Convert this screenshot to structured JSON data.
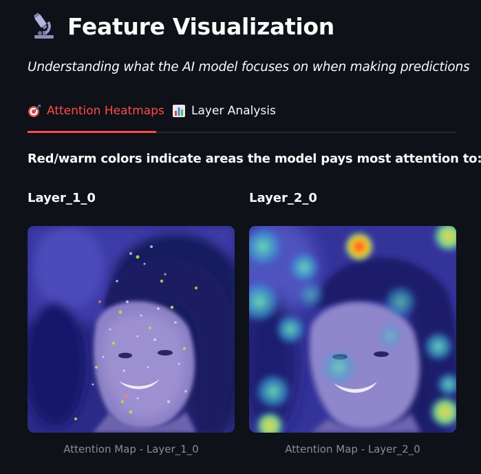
{
  "header": {
    "title": "Feature Visualization",
    "title_icon": "microscope-icon",
    "subtitle": "Understanding what the AI model focuses on when making predictions"
  },
  "tabs": [
    {
      "label": "Attention Heatmaps",
      "icon": "target-icon",
      "active": true
    },
    {
      "label": "Layer Analysis",
      "icon": "bar-chart-icon",
      "active": false
    }
  ],
  "main": {
    "instructions": "Red/warm colors indicate areas the model pays most attention to:",
    "panels": [
      {
        "heading": "Layer_1_0",
        "caption": "Attention Map - Layer_1_0"
      },
      {
        "heading": "Layer_2_0",
        "caption": "Attention Map - Layer_2_0"
      }
    ]
  },
  "colors": {
    "background": "#0e1117",
    "accent": "#ff4b4b",
    "text": "#fafafa",
    "caption": "#8a8d96",
    "tab_border": "#262730"
  }
}
